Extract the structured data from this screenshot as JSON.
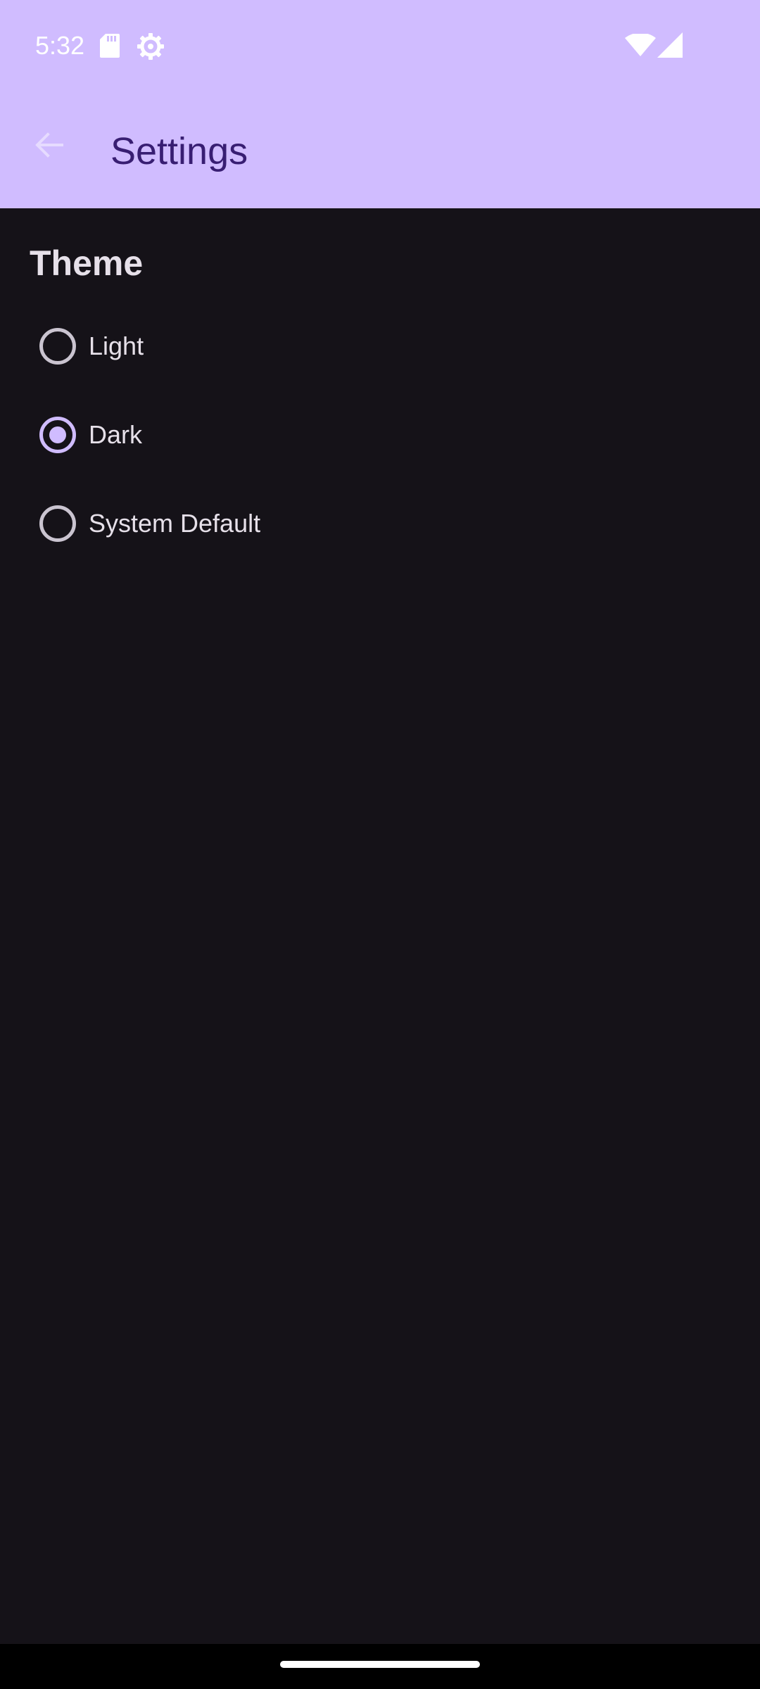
{
  "status_bar": {
    "time": "5:32",
    "icons": [
      "sd-card-icon",
      "gear-icon",
      "wifi-icon",
      "signal-icon"
    ]
  },
  "app_bar": {
    "title": "Settings",
    "back_icon": "arrow-back-icon"
  },
  "theme_section": {
    "title": "Theme",
    "options": [
      {
        "label": "Light",
        "selected": false
      },
      {
        "label": "Dark",
        "selected": true
      },
      {
        "label": "System Default",
        "selected": false
      }
    ]
  },
  "colors": {
    "header_background": "#d0bcff",
    "title_text": "#381e72",
    "page_background": "#151218",
    "radio_selected": "#d0bcff",
    "radio_unselected": "#cac4d0",
    "body_text": "#e6e0e9"
  }
}
